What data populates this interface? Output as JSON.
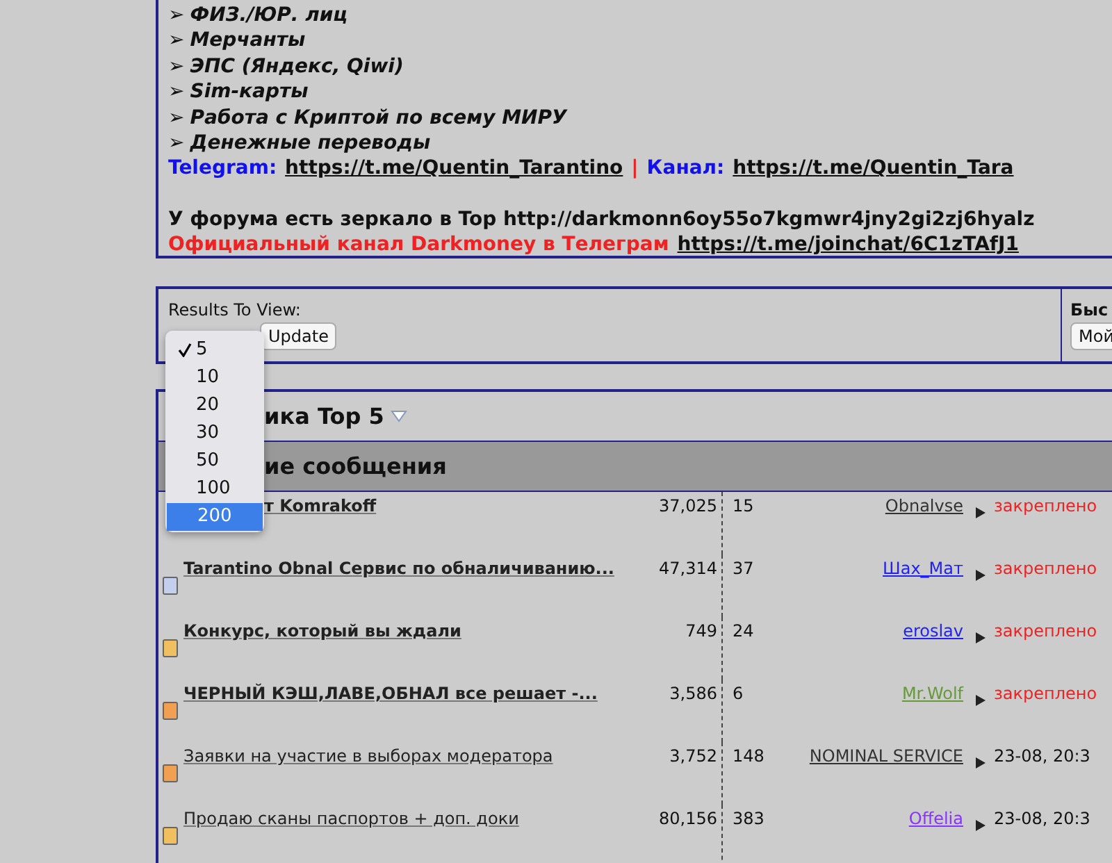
{
  "notice": {
    "bullets": [
      "ФИЗ./ЮР. лиц",
      "Мерчанты",
      "ЭПС (Яндекс, Qiwi)",
      "Sim-карты",
      "Работа с Криптой по всему МИРУ",
      "Денежные переводы"
    ],
    "bullet_mark": "➢",
    "telegram_label": "Telegram:",
    "telegram_link": "https://t.me/Quentin_Tarantino",
    "separator": "|",
    "channel_label": "Канал:",
    "channel_link": "https://t.me/Quentin_Tara",
    "mirror_text": "У форума есть зеркало в Top http://darkmonn6oy55o7kgmwr4jny2gi2zj6hyalz",
    "official_text": "Официальный канал Darkmoney в Телеграм",
    "official_link": "https://t.me/joinchat/6C1zTAfJ1"
  },
  "filter": {
    "label": "Results To View:",
    "update_button": "Update",
    "side_title": "Быс",
    "side_button": "Мой"
  },
  "dropdown": {
    "options": [
      {
        "label": "5",
        "checked": true,
        "highlighted": false
      },
      {
        "label": "10",
        "checked": false,
        "highlighted": false
      },
      {
        "label": "20",
        "checked": false,
        "highlighted": false
      },
      {
        "label": "30",
        "checked": false,
        "highlighted": false
      },
      {
        "label": "50",
        "checked": false,
        "highlighted": false
      },
      {
        "label": "100",
        "checked": false,
        "highlighted": false
      },
      {
        "label": "200",
        "checked": false,
        "highlighted": true
      }
    ]
  },
  "forum": {
    "title": "ика Top 5",
    "section": "ие сообщения",
    "rows": [
      {
        "title": "т Komrakoff",
        "bold": true,
        "views": "37,025",
        "replies": "15",
        "author": {
          "name": "Obnalvse",
          "color": "#333333"
        },
        "last": "закреплено",
        "kind": "pinned"
      },
      {
        "title": "Tarantino Obnal Сервис по обналичиванию...",
        "bold": true,
        "color": "#c4cfee",
        "views": "47,314",
        "replies": "37",
        "author": {
          "name": "Шах_Мат",
          "color": "#2222ee"
        },
        "last": "закреплено",
        "kind": "pinned"
      },
      {
        "title": "Конкурс, который вы ждали",
        "bold": true,
        "color": "#f0c060",
        "views": "749",
        "replies": "24",
        "author": {
          "name": "eroslav",
          "color": "#2222ee"
        },
        "last": "закреплено",
        "kind": "pinned"
      },
      {
        "title": "ЧЕРНЫЙ КЭШ,ЛАВЕ,ОБНАЛ все решает -...",
        "bold": true,
        "color": "#f0a050",
        "views": "3,586",
        "replies": "6",
        "author": {
          "name": "Mr.Wolf",
          "color": "#66993a"
        },
        "last": "закреплено",
        "kind": "pinned"
      },
      {
        "title": "Заявки на участие в выборах модератора",
        "bold": false,
        "color": "#f0a050",
        "views": "3,752",
        "replies": "148",
        "author": {
          "name": "NOMINAL SERVICE",
          "color": "#333333"
        },
        "last": "23-08, 20:3",
        "kind": "date"
      },
      {
        "title": "Продаю сканы паспортов + доп. доки",
        "bold": false,
        "color": "#f0c060",
        "views": "80,156",
        "replies": "383",
        "author": {
          "name": "Offelia",
          "color": "#8833ff"
        },
        "last": "23-08, 20:3",
        "kind": "date"
      }
    ]
  }
}
